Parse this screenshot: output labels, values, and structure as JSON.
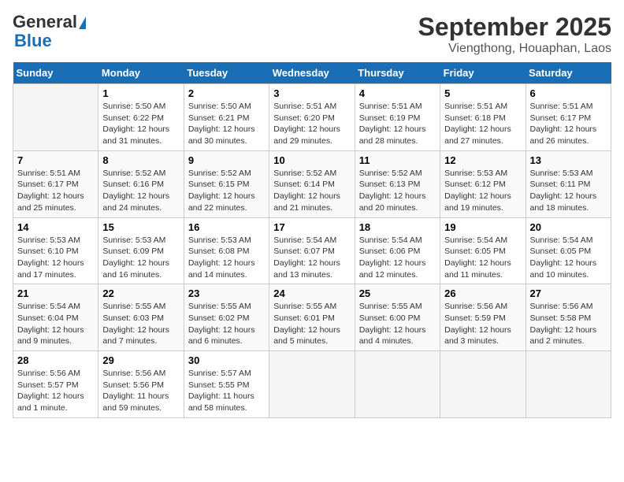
{
  "header": {
    "logo_line1": "General",
    "logo_line2": "Blue",
    "title": "September 2025",
    "subtitle": "Viengthong, Houaphan, Laos"
  },
  "days_of_week": [
    "Sunday",
    "Monday",
    "Tuesday",
    "Wednesday",
    "Thursday",
    "Friday",
    "Saturday"
  ],
  "weeks": [
    [
      {
        "day": "",
        "info": ""
      },
      {
        "day": "1",
        "info": "Sunrise: 5:50 AM\nSunset: 6:22 PM\nDaylight: 12 hours and 31 minutes."
      },
      {
        "day": "2",
        "info": "Sunrise: 5:50 AM\nSunset: 6:21 PM\nDaylight: 12 hours and 30 minutes."
      },
      {
        "day": "3",
        "info": "Sunrise: 5:51 AM\nSunset: 6:20 PM\nDaylight: 12 hours and 29 minutes."
      },
      {
        "day": "4",
        "info": "Sunrise: 5:51 AM\nSunset: 6:19 PM\nDaylight: 12 hours and 28 minutes."
      },
      {
        "day": "5",
        "info": "Sunrise: 5:51 AM\nSunset: 6:18 PM\nDaylight: 12 hours and 27 minutes."
      },
      {
        "day": "6",
        "info": "Sunrise: 5:51 AM\nSunset: 6:17 PM\nDaylight: 12 hours and 26 minutes."
      }
    ],
    [
      {
        "day": "7",
        "info": "Sunrise: 5:51 AM\nSunset: 6:17 PM\nDaylight: 12 hours and 25 minutes."
      },
      {
        "day": "8",
        "info": "Sunrise: 5:52 AM\nSunset: 6:16 PM\nDaylight: 12 hours and 24 minutes."
      },
      {
        "day": "9",
        "info": "Sunrise: 5:52 AM\nSunset: 6:15 PM\nDaylight: 12 hours and 22 minutes."
      },
      {
        "day": "10",
        "info": "Sunrise: 5:52 AM\nSunset: 6:14 PM\nDaylight: 12 hours and 21 minutes."
      },
      {
        "day": "11",
        "info": "Sunrise: 5:52 AM\nSunset: 6:13 PM\nDaylight: 12 hours and 20 minutes."
      },
      {
        "day": "12",
        "info": "Sunrise: 5:53 AM\nSunset: 6:12 PM\nDaylight: 12 hours and 19 minutes."
      },
      {
        "day": "13",
        "info": "Sunrise: 5:53 AM\nSunset: 6:11 PM\nDaylight: 12 hours and 18 minutes."
      }
    ],
    [
      {
        "day": "14",
        "info": "Sunrise: 5:53 AM\nSunset: 6:10 PM\nDaylight: 12 hours and 17 minutes."
      },
      {
        "day": "15",
        "info": "Sunrise: 5:53 AM\nSunset: 6:09 PM\nDaylight: 12 hours and 16 minutes."
      },
      {
        "day": "16",
        "info": "Sunrise: 5:53 AM\nSunset: 6:08 PM\nDaylight: 12 hours and 14 minutes."
      },
      {
        "day": "17",
        "info": "Sunrise: 5:54 AM\nSunset: 6:07 PM\nDaylight: 12 hours and 13 minutes."
      },
      {
        "day": "18",
        "info": "Sunrise: 5:54 AM\nSunset: 6:06 PM\nDaylight: 12 hours and 12 minutes."
      },
      {
        "day": "19",
        "info": "Sunrise: 5:54 AM\nSunset: 6:05 PM\nDaylight: 12 hours and 11 minutes."
      },
      {
        "day": "20",
        "info": "Sunrise: 5:54 AM\nSunset: 6:05 PM\nDaylight: 12 hours and 10 minutes."
      }
    ],
    [
      {
        "day": "21",
        "info": "Sunrise: 5:54 AM\nSunset: 6:04 PM\nDaylight: 12 hours and 9 minutes."
      },
      {
        "day": "22",
        "info": "Sunrise: 5:55 AM\nSunset: 6:03 PM\nDaylight: 12 hours and 7 minutes."
      },
      {
        "day": "23",
        "info": "Sunrise: 5:55 AM\nSunset: 6:02 PM\nDaylight: 12 hours and 6 minutes."
      },
      {
        "day": "24",
        "info": "Sunrise: 5:55 AM\nSunset: 6:01 PM\nDaylight: 12 hours and 5 minutes."
      },
      {
        "day": "25",
        "info": "Sunrise: 5:55 AM\nSunset: 6:00 PM\nDaylight: 12 hours and 4 minutes."
      },
      {
        "day": "26",
        "info": "Sunrise: 5:56 AM\nSunset: 5:59 PM\nDaylight: 12 hours and 3 minutes."
      },
      {
        "day": "27",
        "info": "Sunrise: 5:56 AM\nSunset: 5:58 PM\nDaylight: 12 hours and 2 minutes."
      }
    ],
    [
      {
        "day": "28",
        "info": "Sunrise: 5:56 AM\nSunset: 5:57 PM\nDaylight: 12 hours and 1 minute."
      },
      {
        "day": "29",
        "info": "Sunrise: 5:56 AM\nSunset: 5:56 PM\nDaylight: 11 hours and 59 minutes."
      },
      {
        "day": "30",
        "info": "Sunrise: 5:57 AM\nSunset: 5:55 PM\nDaylight: 11 hours and 58 minutes."
      },
      {
        "day": "",
        "info": ""
      },
      {
        "day": "",
        "info": ""
      },
      {
        "day": "",
        "info": ""
      },
      {
        "day": "",
        "info": ""
      }
    ]
  ]
}
